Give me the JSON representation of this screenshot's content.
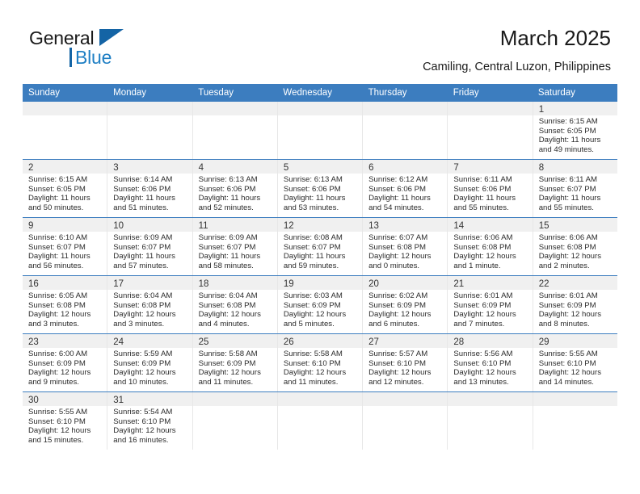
{
  "brand": {
    "name_top": "General",
    "name_bottom": "Blue",
    "accent_color": "#1f7fc4",
    "triangle_color": "#1464a5"
  },
  "header": {
    "title": "March 2025",
    "subtitle": "Camiling, Central Luzon, Philippines"
  },
  "calendar": {
    "header_color": "#3C7DBF",
    "weekdays": [
      "Sunday",
      "Monday",
      "Tuesday",
      "Wednesday",
      "Thursday",
      "Friday",
      "Saturday"
    ],
    "weeks": [
      [
        {
          "empty": true
        },
        {
          "empty": true
        },
        {
          "empty": true
        },
        {
          "empty": true
        },
        {
          "empty": true
        },
        {
          "empty": true
        },
        {
          "day": "1",
          "sunrise": "Sunrise: 6:15 AM",
          "sunset": "Sunset: 6:05 PM",
          "daylight": "Daylight: 11 hours and 49 minutes."
        }
      ],
      [
        {
          "day": "2",
          "sunrise": "Sunrise: 6:15 AM",
          "sunset": "Sunset: 6:05 PM",
          "daylight": "Daylight: 11 hours and 50 minutes."
        },
        {
          "day": "3",
          "sunrise": "Sunrise: 6:14 AM",
          "sunset": "Sunset: 6:06 PM",
          "daylight": "Daylight: 11 hours and 51 minutes."
        },
        {
          "day": "4",
          "sunrise": "Sunrise: 6:13 AM",
          "sunset": "Sunset: 6:06 PM",
          "daylight": "Daylight: 11 hours and 52 minutes."
        },
        {
          "day": "5",
          "sunrise": "Sunrise: 6:13 AM",
          "sunset": "Sunset: 6:06 PM",
          "daylight": "Daylight: 11 hours and 53 minutes."
        },
        {
          "day": "6",
          "sunrise": "Sunrise: 6:12 AM",
          "sunset": "Sunset: 6:06 PM",
          "daylight": "Daylight: 11 hours and 54 minutes."
        },
        {
          "day": "7",
          "sunrise": "Sunrise: 6:11 AM",
          "sunset": "Sunset: 6:06 PM",
          "daylight": "Daylight: 11 hours and 55 minutes."
        },
        {
          "day": "8",
          "sunrise": "Sunrise: 6:11 AM",
          "sunset": "Sunset: 6:07 PM",
          "daylight": "Daylight: 11 hours and 55 minutes."
        }
      ],
      [
        {
          "day": "9",
          "sunrise": "Sunrise: 6:10 AM",
          "sunset": "Sunset: 6:07 PM",
          "daylight": "Daylight: 11 hours and 56 minutes."
        },
        {
          "day": "10",
          "sunrise": "Sunrise: 6:09 AM",
          "sunset": "Sunset: 6:07 PM",
          "daylight": "Daylight: 11 hours and 57 minutes."
        },
        {
          "day": "11",
          "sunrise": "Sunrise: 6:09 AM",
          "sunset": "Sunset: 6:07 PM",
          "daylight": "Daylight: 11 hours and 58 minutes."
        },
        {
          "day": "12",
          "sunrise": "Sunrise: 6:08 AM",
          "sunset": "Sunset: 6:07 PM",
          "daylight": "Daylight: 11 hours and 59 minutes."
        },
        {
          "day": "13",
          "sunrise": "Sunrise: 6:07 AM",
          "sunset": "Sunset: 6:08 PM",
          "daylight": "Daylight: 12 hours and 0 minutes."
        },
        {
          "day": "14",
          "sunrise": "Sunrise: 6:06 AM",
          "sunset": "Sunset: 6:08 PM",
          "daylight": "Daylight: 12 hours and 1 minute."
        },
        {
          "day": "15",
          "sunrise": "Sunrise: 6:06 AM",
          "sunset": "Sunset: 6:08 PM",
          "daylight": "Daylight: 12 hours and 2 minutes."
        }
      ],
      [
        {
          "day": "16",
          "sunrise": "Sunrise: 6:05 AM",
          "sunset": "Sunset: 6:08 PM",
          "daylight": "Daylight: 12 hours and 3 minutes."
        },
        {
          "day": "17",
          "sunrise": "Sunrise: 6:04 AM",
          "sunset": "Sunset: 6:08 PM",
          "daylight": "Daylight: 12 hours and 3 minutes."
        },
        {
          "day": "18",
          "sunrise": "Sunrise: 6:04 AM",
          "sunset": "Sunset: 6:08 PM",
          "daylight": "Daylight: 12 hours and 4 minutes."
        },
        {
          "day": "19",
          "sunrise": "Sunrise: 6:03 AM",
          "sunset": "Sunset: 6:09 PM",
          "daylight": "Daylight: 12 hours and 5 minutes."
        },
        {
          "day": "20",
          "sunrise": "Sunrise: 6:02 AM",
          "sunset": "Sunset: 6:09 PM",
          "daylight": "Daylight: 12 hours and 6 minutes."
        },
        {
          "day": "21",
          "sunrise": "Sunrise: 6:01 AM",
          "sunset": "Sunset: 6:09 PM",
          "daylight": "Daylight: 12 hours and 7 minutes."
        },
        {
          "day": "22",
          "sunrise": "Sunrise: 6:01 AM",
          "sunset": "Sunset: 6:09 PM",
          "daylight": "Daylight: 12 hours and 8 minutes."
        }
      ],
      [
        {
          "day": "23",
          "sunrise": "Sunrise: 6:00 AM",
          "sunset": "Sunset: 6:09 PM",
          "daylight": "Daylight: 12 hours and 9 minutes."
        },
        {
          "day": "24",
          "sunrise": "Sunrise: 5:59 AM",
          "sunset": "Sunset: 6:09 PM",
          "daylight": "Daylight: 12 hours and 10 minutes."
        },
        {
          "day": "25",
          "sunrise": "Sunrise: 5:58 AM",
          "sunset": "Sunset: 6:09 PM",
          "daylight": "Daylight: 12 hours and 11 minutes."
        },
        {
          "day": "26",
          "sunrise": "Sunrise: 5:58 AM",
          "sunset": "Sunset: 6:10 PM",
          "daylight": "Daylight: 12 hours and 11 minutes."
        },
        {
          "day": "27",
          "sunrise": "Sunrise: 5:57 AM",
          "sunset": "Sunset: 6:10 PM",
          "daylight": "Daylight: 12 hours and 12 minutes."
        },
        {
          "day": "28",
          "sunrise": "Sunrise: 5:56 AM",
          "sunset": "Sunset: 6:10 PM",
          "daylight": "Daylight: 12 hours and 13 minutes."
        },
        {
          "day": "29",
          "sunrise": "Sunrise: 5:55 AM",
          "sunset": "Sunset: 6:10 PM",
          "daylight": "Daylight: 12 hours and 14 minutes."
        }
      ],
      [
        {
          "day": "30",
          "sunrise": "Sunrise: 5:55 AM",
          "sunset": "Sunset: 6:10 PM",
          "daylight": "Daylight: 12 hours and 15 minutes."
        },
        {
          "day": "31",
          "sunrise": "Sunrise: 5:54 AM",
          "sunset": "Sunset: 6:10 PM",
          "daylight": "Daylight: 12 hours and 16 minutes."
        },
        {
          "empty": true
        },
        {
          "empty": true
        },
        {
          "empty": true
        },
        {
          "empty": true
        },
        {
          "empty": true
        }
      ]
    ]
  }
}
